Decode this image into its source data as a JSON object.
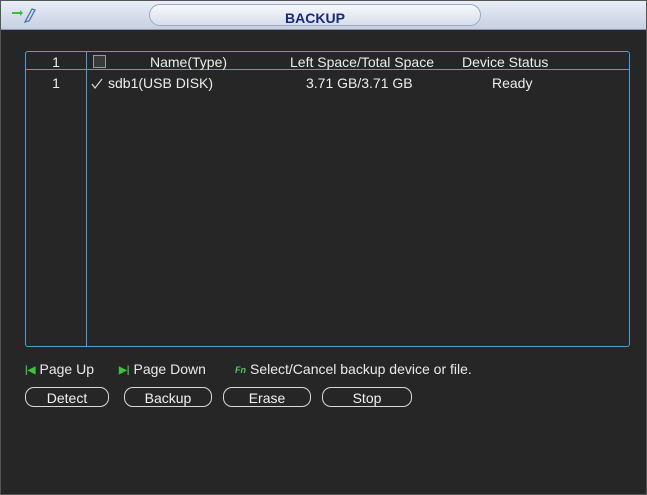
{
  "window": {
    "title": "BACKUP"
  },
  "table": {
    "headers": {
      "num": "1",
      "name": "Name(Type)",
      "space": "Left Space/Total Space",
      "status": "Device Status"
    },
    "rows": [
      {
        "num": "1",
        "checked": true,
        "name": "sdb1(USB DISK)",
        "space": "3.71 GB/3.71 GB",
        "status": "Ready"
      }
    ]
  },
  "hints": {
    "page_up": "Page Up",
    "page_down": "Page Down",
    "select_cancel": "Select/Cancel backup device or file."
  },
  "buttons": {
    "detect": "Detect",
    "backup": "Backup",
    "erase": "Erase",
    "stop": "Stop"
  },
  "colors": {
    "panel_border": "#4aa0d8",
    "title_text": "#1b2a78",
    "hint_icon": "#39c43a"
  },
  "icons": {
    "app": "folder-pen-icon",
    "page_up": "page-up-icon",
    "page_down": "page-down-icon",
    "fn": "fn-key-icon",
    "row_check": "checkmark-icon"
  }
}
